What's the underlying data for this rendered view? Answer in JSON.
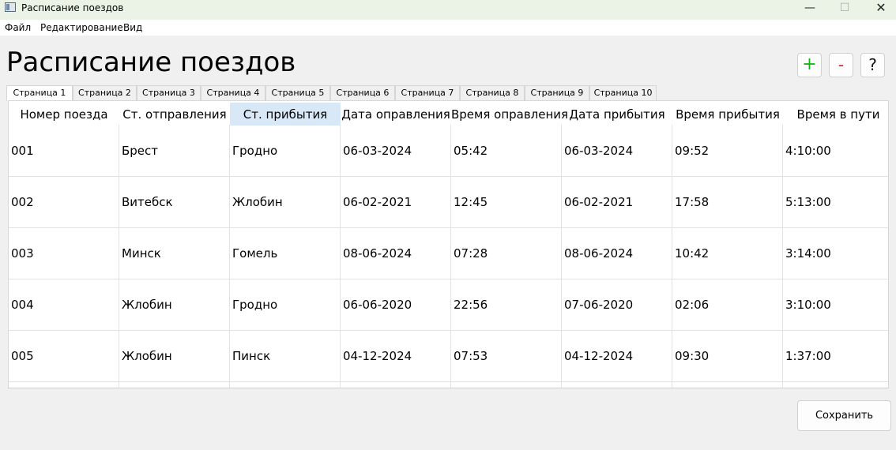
{
  "window": {
    "title": "Расписание поездов",
    "minimize_glyph": "—",
    "maximize_glyph": "☐",
    "close_glyph": "✕"
  },
  "menu": [
    {
      "label": "Файл"
    },
    {
      "label": "Редактирование"
    },
    {
      "label": "Вид"
    }
  ],
  "header": {
    "title": "Расписание поездов"
  },
  "toolbar": {
    "add_label": "+",
    "remove_label": "-",
    "help_label": "?",
    "add_color": "#18b518",
    "remove_color": "#d62020"
  },
  "tabs": [
    {
      "label": "Страница 1",
      "active": true
    },
    {
      "label": "Страница 2"
    },
    {
      "label": "Страница 3"
    },
    {
      "label": "Страница 4"
    },
    {
      "label": "Страница 5"
    },
    {
      "label": "Страница 6"
    },
    {
      "label": "Страница 7"
    },
    {
      "label": "Страница 8"
    },
    {
      "label": "Страница 9"
    },
    {
      "label": "Страница 10"
    }
  ],
  "table": {
    "selected_column": 2,
    "selected_color": "#d9e8f7",
    "columns": [
      "Номер поезда",
      "Ст. отправления",
      "Ст. прибытия",
      "Дата оправления",
      "Время оправления",
      "Дата прибытия",
      "Время прибытия",
      "Время в пути"
    ],
    "rows": [
      [
        "001",
        "Брест",
        "Гродно",
        "06-03-2024",
        "05:42",
        "06-03-2024",
        "09:52",
        "4:10:00"
      ],
      [
        "002",
        "Витебск",
        "Жлобин",
        "06-02-2021",
        "12:45",
        "06-02-2021",
        "17:58",
        "5:13:00"
      ],
      [
        "003",
        "Минск",
        "Гомель",
        "08-06-2024",
        "07:28",
        "08-06-2024",
        "10:42",
        "3:14:00"
      ],
      [
        "004",
        "Жлобин",
        "Гродно",
        "06-06-2020",
        "22:56",
        "07-06-2020",
        "02:06",
        "3:10:00"
      ],
      [
        "005",
        "Жлобин",
        "Пинск",
        "04-12-2024",
        "07:53",
        "04-12-2024",
        "09:30",
        "1:37:00"
      ]
    ]
  },
  "footer": {
    "save_label": "Сохранить"
  }
}
